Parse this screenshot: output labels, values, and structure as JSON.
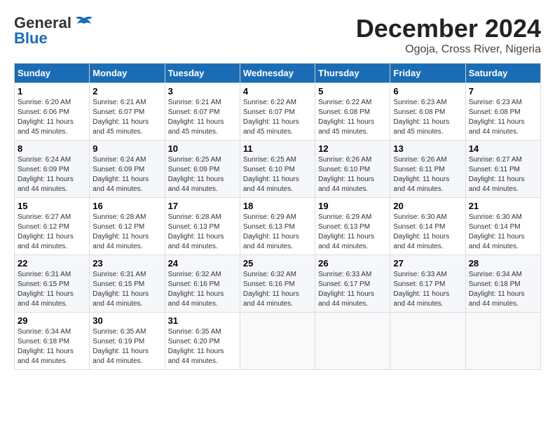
{
  "header": {
    "logo_line1": "General",
    "logo_line2": "Blue",
    "month_title": "December 2024",
    "subtitle": "Ogoja, Cross River, Nigeria"
  },
  "weekdays": [
    "Sunday",
    "Monday",
    "Tuesday",
    "Wednesday",
    "Thursday",
    "Friday",
    "Saturday"
  ],
  "weeks": [
    [
      {
        "day": "1",
        "sunrise": "6:20 AM",
        "sunset": "6:06 PM",
        "daylight": "11 hours and 45 minutes."
      },
      {
        "day": "2",
        "sunrise": "6:21 AM",
        "sunset": "6:07 PM",
        "daylight": "11 hours and 45 minutes."
      },
      {
        "day": "3",
        "sunrise": "6:21 AM",
        "sunset": "6:07 PM",
        "daylight": "11 hours and 45 minutes."
      },
      {
        "day": "4",
        "sunrise": "6:22 AM",
        "sunset": "6:07 PM",
        "daylight": "11 hours and 45 minutes."
      },
      {
        "day": "5",
        "sunrise": "6:22 AM",
        "sunset": "6:08 PM",
        "daylight": "11 hours and 45 minutes."
      },
      {
        "day": "6",
        "sunrise": "6:23 AM",
        "sunset": "6:08 PM",
        "daylight": "11 hours and 45 minutes."
      },
      {
        "day": "7",
        "sunrise": "6:23 AM",
        "sunset": "6:08 PM",
        "daylight": "11 hours and 44 minutes."
      }
    ],
    [
      {
        "day": "8",
        "sunrise": "6:24 AM",
        "sunset": "6:09 PM",
        "daylight": "11 hours and 44 minutes."
      },
      {
        "day": "9",
        "sunrise": "6:24 AM",
        "sunset": "6:09 PM",
        "daylight": "11 hours and 44 minutes."
      },
      {
        "day": "10",
        "sunrise": "6:25 AM",
        "sunset": "6:09 PM",
        "daylight": "11 hours and 44 minutes."
      },
      {
        "day": "11",
        "sunrise": "6:25 AM",
        "sunset": "6:10 PM",
        "daylight": "11 hours and 44 minutes."
      },
      {
        "day": "12",
        "sunrise": "6:26 AM",
        "sunset": "6:10 PM",
        "daylight": "11 hours and 44 minutes."
      },
      {
        "day": "13",
        "sunrise": "6:26 AM",
        "sunset": "6:11 PM",
        "daylight": "11 hours and 44 minutes."
      },
      {
        "day": "14",
        "sunrise": "6:27 AM",
        "sunset": "6:11 PM",
        "daylight": "11 hours and 44 minutes."
      }
    ],
    [
      {
        "day": "15",
        "sunrise": "6:27 AM",
        "sunset": "6:12 PM",
        "daylight": "11 hours and 44 minutes."
      },
      {
        "day": "16",
        "sunrise": "6:28 AM",
        "sunset": "6:12 PM",
        "daylight": "11 hours and 44 minutes."
      },
      {
        "day": "17",
        "sunrise": "6:28 AM",
        "sunset": "6:13 PM",
        "daylight": "11 hours and 44 minutes."
      },
      {
        "day": "18",
        "sunrise": "6:29 AM",
        "sunset": "6:13 PM",
        "daylight": "11 hours and 44 minutes."
      },
      {
        "day": "19",
        "sunrise": "6:29 AM",
        "sunset": "6:13 PM",
        "daylight": "11 hours and 44 minutes."
      },
      {
        "day": "20",
        "sunrise": "6:30 AM",
        "sunset": "6:14 PM",
        "daylight": "11 hours and 44 minutes."
      },
      {
        "day": "21",
        "sunrise": "6:30 AM",
        "sunset": "6:14 PM",
        "daylight": "11 hours and 44 minutes."
      }
    ],
    [
      {
        "day": "22",
        "sunrise": "6:31 AM",
        "sunset": "6:15 PM",
        "daylight": "11 hours and 44 minutes."
      },
      {
        "day": "23",
        "sunrise": "6:31 AM",
        "sunset": "6:15 PM",
        "daylight": "11 hours and 44 minutes."
      },
      {
        "day": "24",
        "sunrise": "6:32 AM",
        "sunset": "6:16 PM",
        "daylight": "11 hours and 44 minutes."
      },
      {
        "day": "25",
        "sunrise": "6:32 AM",
        "sunset": "6:16 PM",
        "daylight": "11 hours and 44 minutes."
      },
      {
        "day": "26",
        "sunrise": "6:33 AM",
        "sunset": "6:17 PM",
        "daylight": "11 hours and 44 minutes."
      },
      {
        "day": "27",
        "sunrise": "6:33 AM",
        "sunset": "6:17 PM",
        "daylight": "11 hours and 44 minutes."
      },
      {
        "day": "28",
        "sunrise": "6:34 AM",
        "sunset": "6:18 PM",
        "daylight": "11 hours and 44 minutes."
      }
    ],
    [
      {
        "day": "29",
        "sunrise": "6:34 AM",
        "sunset": "6:18 PM",
        "daylight": "11 hours and 44 minutes."
      },
      {
        "day": "30",
        "sunrise": "6:35 AM",
        "sunset": "6:19 PM",
        "daylight": "11 hours and 44 minutes."
      },
      {
        "day": "31",
        "sunrise": "6:35 AM",
        "sunset": "6:20 PM",
        "daylight": "11 hours and 44 minutes."
      },
      null,
      null,
      null,
      null
    ]
  ]
}
